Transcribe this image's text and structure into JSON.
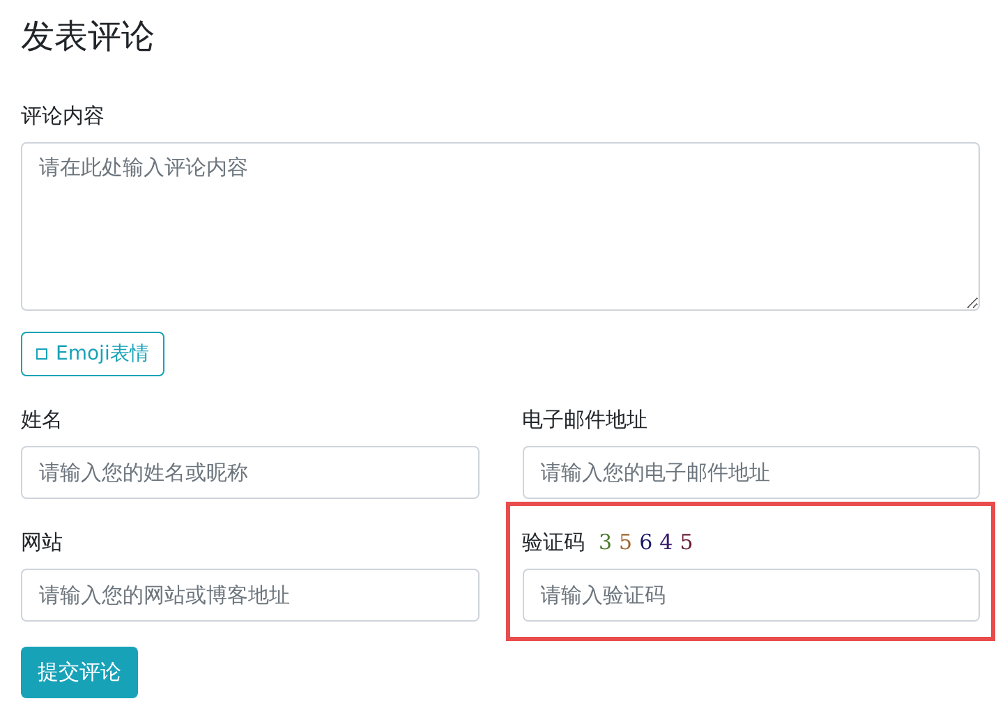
{
  "title": "发表评论",
  "comment": {
    "label": "评论内容",
    "placeholder": "请在此处输入评论内容"
  },
  "emoji_button": {
    "label": "Emoji表情"
  },
  "fields": [
    {
      "kind": "text",
      "label": "姓名",
      "placeholder": "请输入您的姓名或昵称",
      "highlighted": false
    },
    {
      "kind": "text",
      "label": "电子邮件地址",
      "placeholder": "请输入您的电子邮件地址",
      "highlighted": false
    },
    {
      "kind": "text",
      "label": "网站",
      "placeholder": "请输入您的网站或博客地址",
      "highlighted": false
    },
    {
      "kind": "captcha",
      "label": "验证码",
      "captcha": "35645",
      "placeholder": "请输入验证码",
      "highlighted": true
    }
  ],
  "submit_button": {
    "label": "提交评论"
  }
}
